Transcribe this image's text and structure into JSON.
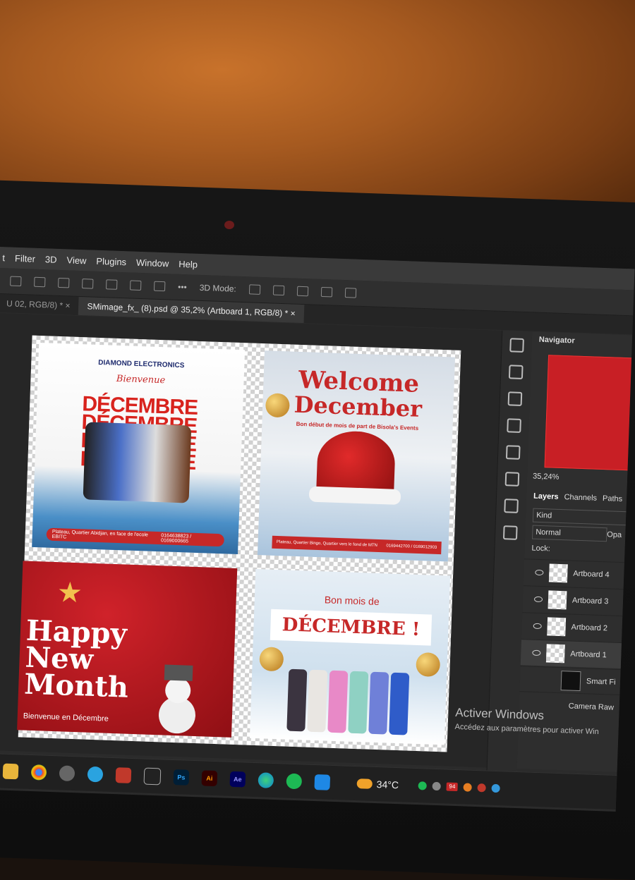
{
  "menu": [
    "t",
    "Filter",
    "3D",
    "View",
    "Plugins",
    "Window",
    "Help"
  ],
  "options_bar": {
    "more": "•••",
    "mode_label": "3D Mode:"
  },
  "tabs": {
    "prev": "U 02, RGB/8) *",
    "close": "×",
    "active": "SMimage_fx_ (8).psd @ 35,2% (Artboard 1, RGB/8) *",
    "active_close": "×"
  },
  "artboard1": {
    "brand": "DIAMOND ELECTRONICS",
    "welcome": "Bienvenue",
    "headline": "DÉCEMBRE",
    "address": "Plateau, Quartier Abidjan, en face de l'ecole EBITC",
    "phone": "0164638823 / 0169000665"
  },
  "artboard2": {
    "title_line1": "Welcome",
    "title_line2": "December",
    "subtitle": "Bon début de mois de part de Bisola's Events",
    "address": "Plateau, Quartier Bingo, Quartier vers le fond de MTN",
    "phone": "0169442700 / 0169012903"
  },
  "artboard3": {
    "line1": "Happy",
    "line2": "New",
    "line3": "Month",
    "subtitle": "Bienvenue en Décembre"
  },
  "artboard4": {
    "title_small": "Bon mois de",
    "title_big": "DÉCEMBRE !"
  },
  "panels": {
    "navigator": "Navigator",
    "zoom": "35,24%",
    "tabs": [
      "Layers",
      "Channels",
      "Paths"
    ],
    "kind": "Kind",
    "blend": "Normal",
    "opacity": "Opa",
    "lock": "Lock:",
    "layers": [
      "Artboard 4",
      "Artboard 3",
      "Artboard 2",
      "Artboard 1"
    ],
    "sublayer1": "Smart Fi",
    "sublayer2": "Camera Raw"
  },
  "watermark": {
    "title": "Activer Windows",
    "subtitle": "Accédez aux paramètres pour activer Win"
  },
  "taskbar": {
    "temperature": "34°C",
    "badge": "94",
    "ps": "Ps",
    "ai": "Ai",
    "ae": "Ae"
  }
}
